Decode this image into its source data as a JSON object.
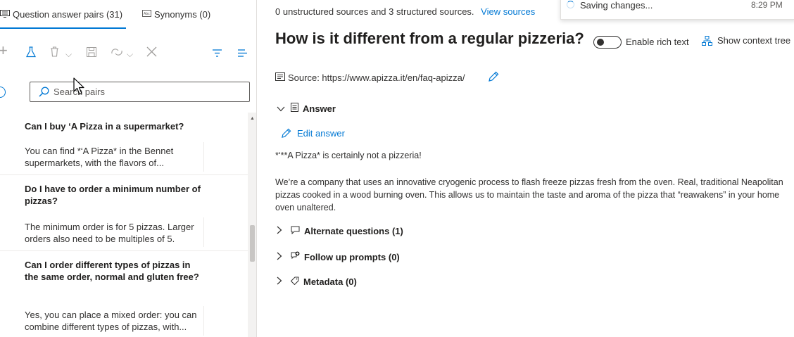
{
  "tabs": [
    {
      "label": "Question answer pairs (31)",
      "icon": "qna-icon"
    },
    {
      "label": "Synonyms (0)",
      "icon": "synonyms-icon"
    }
  ],
  "search": {
    "placeholder": "Search pairs"
  },
  "qa_pairs": [
    {
      "question": "Can I buy ‘A Pizza in a supermarket?",
      "answer": "You can find *‘A Pizza* in the Bennet supermarkets, with the flavors of..."
    },
    {
      "question": "Do I have to order a minimum number of pizzas?",
      "answer": "The minimum order is for 5 pizzas. Larger orders also need to be multiples of 5."
    },
    {
      "question": "Can I order different types of pizzas in the same order, normal and gluten free?",
      "answer": "Yes, you can place a mixed order: you can combine different types of pizzas, with..."
    }
  ],
  "header": {
    "sources_text": "0 unstructured sources and 3 structured sources.",
    "view_sources": "View sources"
  },
  "toast": {
    "message": "Saving changes...",
    "time": "8:29 PM"
  },
  "detail": {
    "title": "How is it different from a regular pizzeria?",
    "rich_text_label": "Enable rich text",
    "context_tree_label": "Show context tree",
    "source": "Source: https://www.apizza.it/en/faq-apizza/",
    "answer_section": "Answer",
    "edit_answer": "Edit answer",
    "answer_line1": "*‘**A Pizza* is certainly not a pizzeria!",
    "answer_line2": "We’re a company that uses an innovative cryogenic process to flash freeze pizzas fresh from the oven. Real, traditional Neapolitan pizzas cooked in a wood burning oven. This allows us to maintain the taste and aroma of the pizza that “reawakens” in your home oven unaltered.",
    "alternate_questions": "Alternate questions (1)",
    "follow_up_prompts": "Follow up prompts (0)",
    "metadata": "Metadata (0)"
  },
  "colors": {
    "accent": "#0078d4",
    "text": "#323130"
  }
}
